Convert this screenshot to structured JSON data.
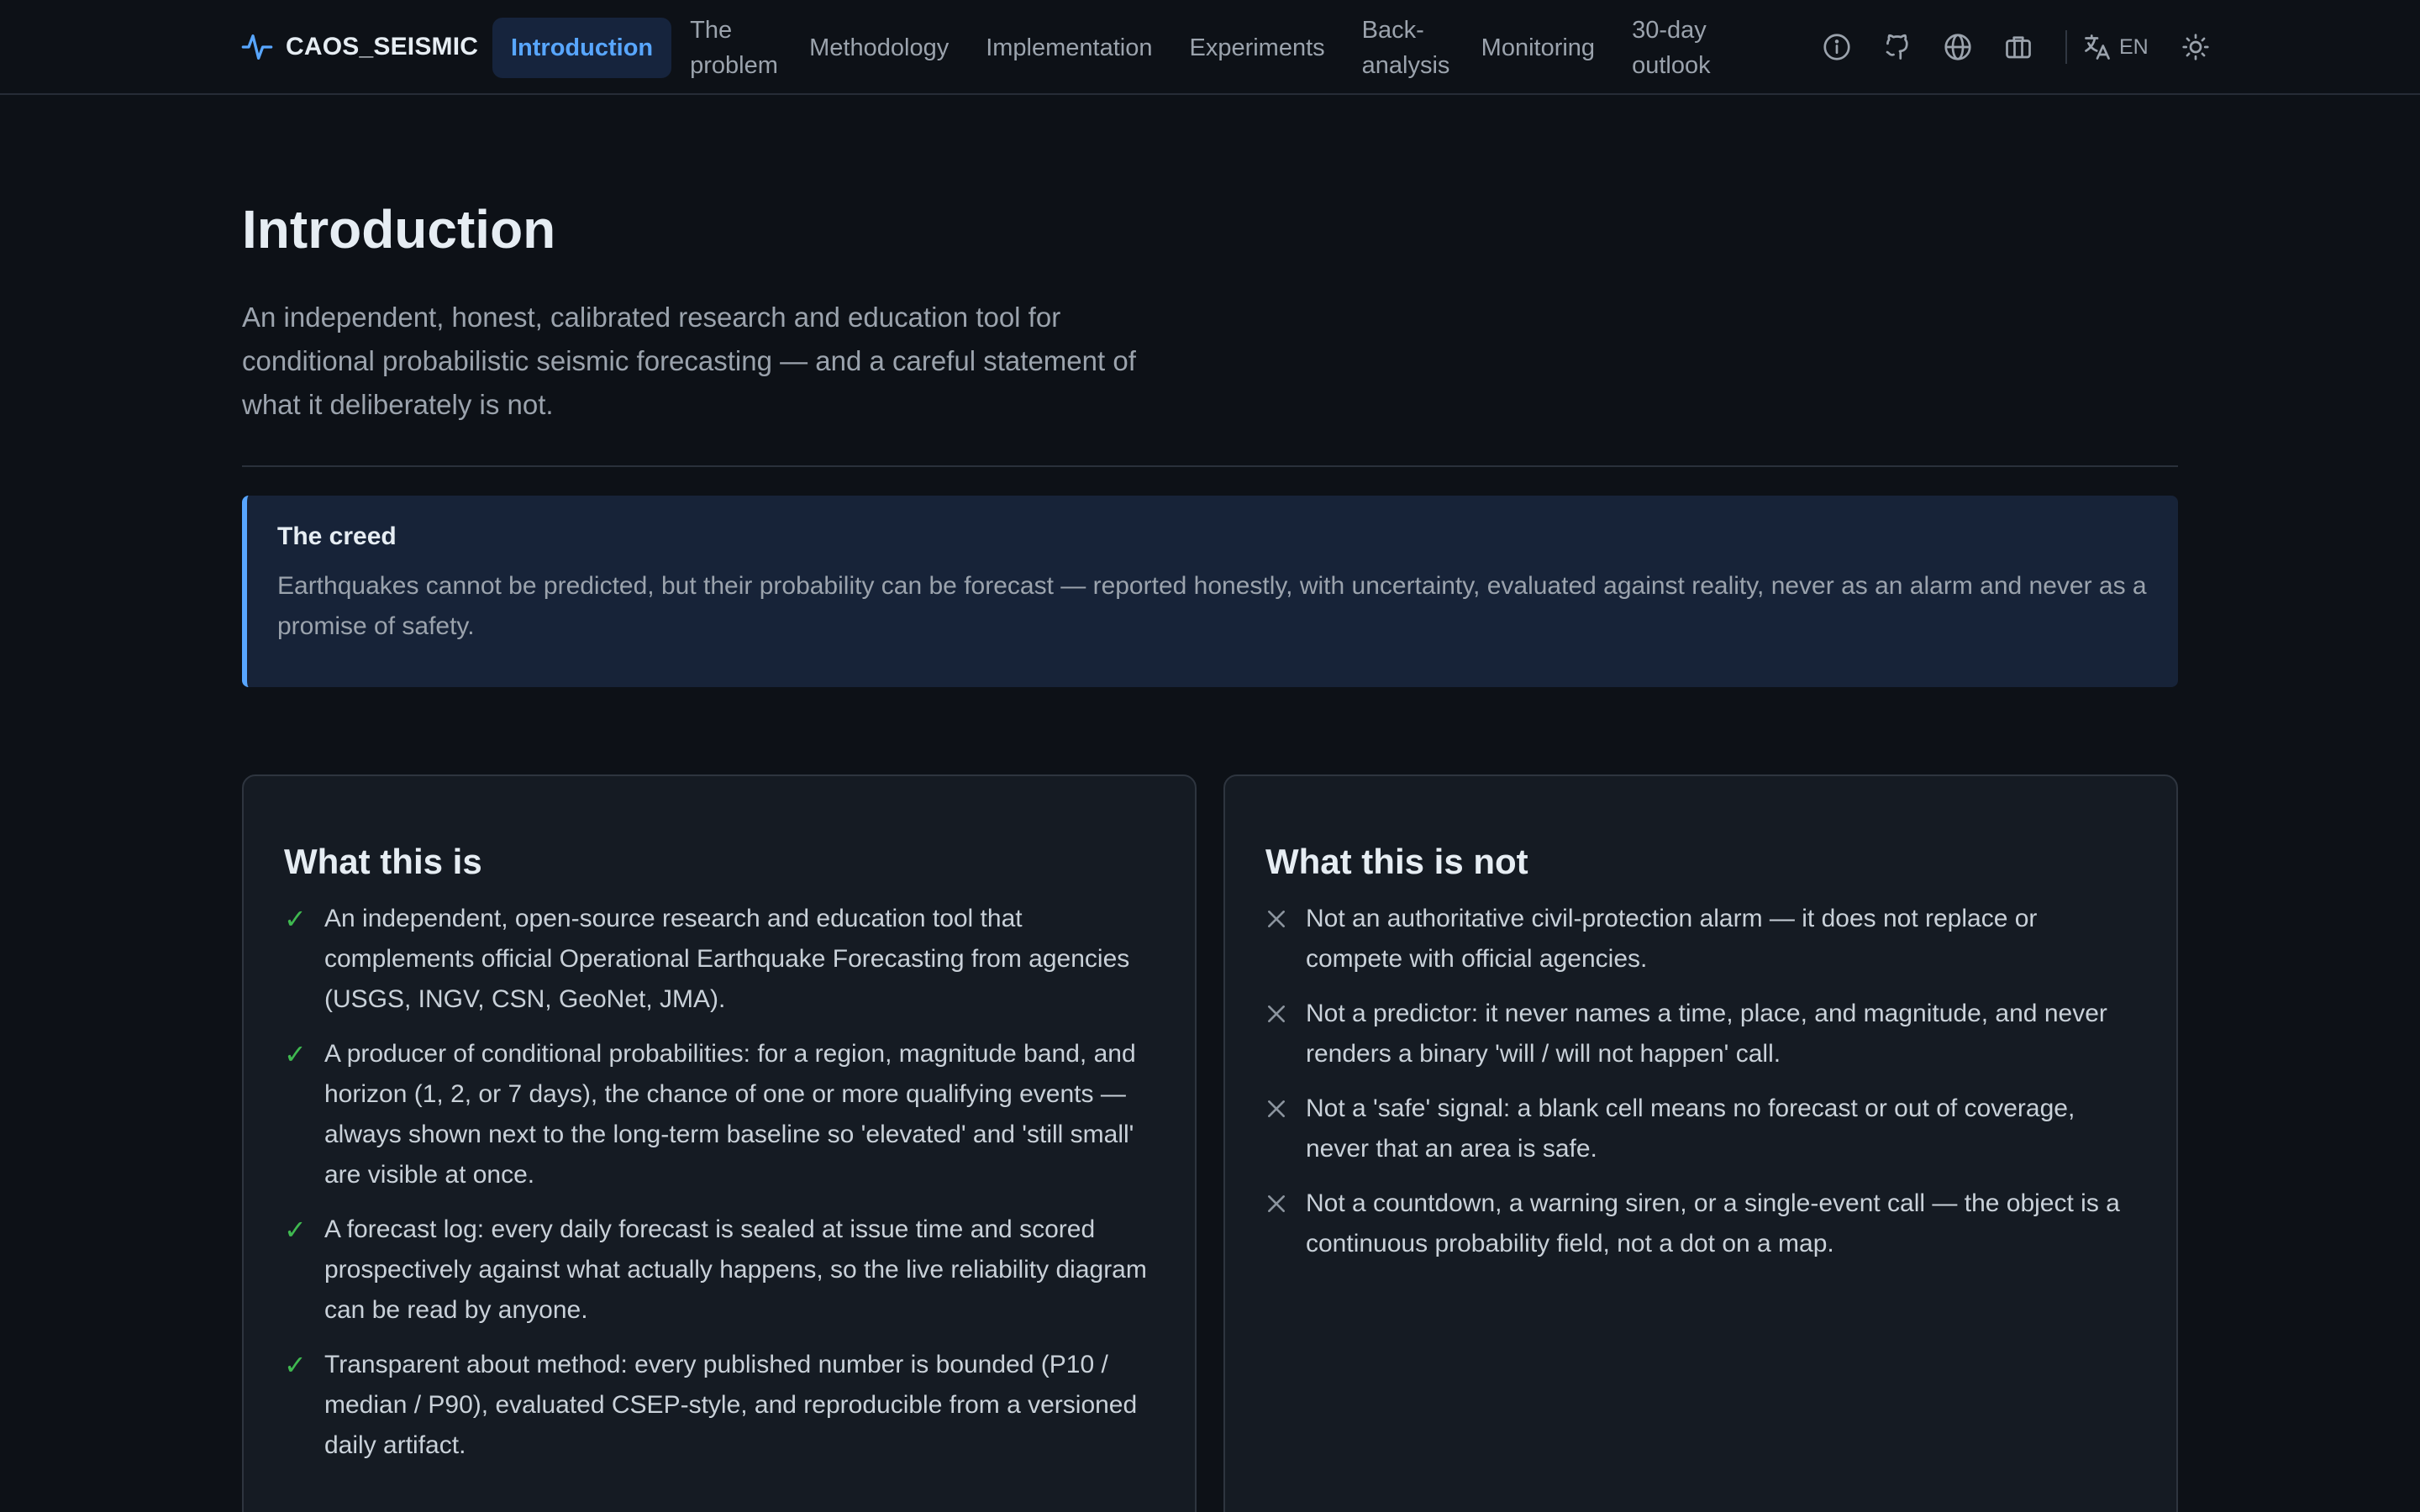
{
  "brand": {
    "name": "CAOS_SEISMIC"
  },
  "nav": {
    "items": [
      {
        "label": "Introduction"
      },
      {
        "label": "The problem"
      },
      {
        "label": "Methodology"
      },
      {
        "label": "Implementation"
      },
      {
        "label": "Experiments"
      },
      {
        "label": "Back-analysis"
      },
      {
        "label": "Monitoring"
      },
      {
        "label": "30-day outlook"
      }
    ],
    "active": "Introduction",
    "icons": [
      "info-icon",
      "github-icon",
      "globe-icon",
      "briefcase-icon",
      "translate-icon",
      "sun-icon"
    ],
    "language": "EN"
  },
  "page": {
    "title": "Introduction",
    "lead": "An independent, honest, calibrated research and education tool for conditional probabilistic seismic forecasting — and a careful statement of what it deliberately is not."
  },
  "creed": {
    "heading": "The creed",
    "text": "Earthquakes cannot be predicted, but their probability can be forecast — reported honestly, with uncertainty, evaluated against reality, never as an alarm and never as a promise of safety."
  },
  "is": {
    "heading": "What this is",
    "items": [
      "An independent, open-source research and education tool that complements official Operational Earthquake Forecasting from agencies (USGS, INGV, CSN, GeoNet, JMA).",
      "A producer of conditional probabilities: for a region, magnitude band, and horizon (1, 2, or 7 days), the chance of one or more qualifying events — always shown next to the long-term baseline so 'elevated' and 'still small' are visible at once.",
      "A forecast log: every daily forecast is sealed at issue time and scored prospectively against what actually happens, so the live reliability diagram can be read by anyone.",
      "Transparent about method: every published number is bounded (P10 / median / P90), evaluated CSEP-style, and reproducible from a versioned daily artifact."
    ]
  },
  "isnot": {
    "heading": "What this is not",
    "items": [
      "Not an authoritative civil-protection alarm — it does not replace or compete with official agencies.",
      "Not a predictor: it never names a time, place, and magnitude, and never renders a binary 'will / will not happen' call.",
      "Not a 'safe' signal: a blank cell means no forecast or out of coverage, never that an area is safe.",
      "Not a countdown, a warning siren, or a single-event call — the object is a continuous probability field, not a dot on a map."
    ]
  },
  "colors": {
    "accent": "#58a6ff",
    "check": "#3fb950",
    "background": "#0d1117"
  }
}
